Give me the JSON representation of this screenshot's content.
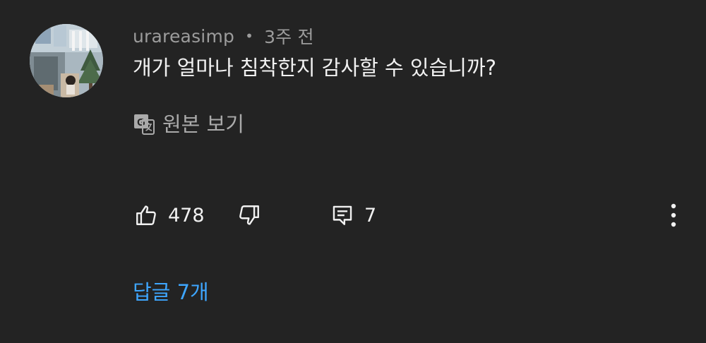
{
  "comment": {
    "author": "urareasimp",
    "separator": "•",
    "time_ago": "3주 전",
    "text": "개가 얼마나 침착한지 감사할 수 있습니까?",
    "translate_label": "원본 보기"
  },
  "actions": {
    "like_count": "478",
    "reply_count": "7",
    "like_icon": "thumbs-up-icon",
    "dislike_icon": "thumbs-down-icon",
    "reply_icon": "comment-icon",
    "more_icon": "more-vertical-icon"
  },
  "replies": {
    "label": "답글 7개"
  },
  "colors": {
    "background": "#232323",
    "text_primary": "#f1f1f1",
    "text_secondary": "#9c9c9c",
    "link": "#3ea6ff"
  }
}
